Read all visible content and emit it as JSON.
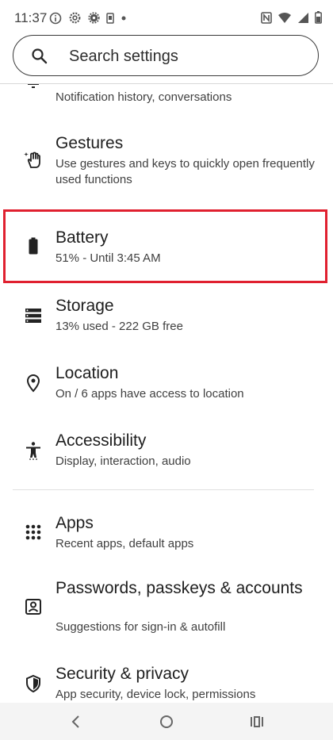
{
  "status_bar": {
    "time": "11:37",
    "left_icons": [
      "info-icon",
      "settings-gear-icon",
      "settings-cog-icon",
      "device-icon",
      "dot-icon"
    ],
    "right_icons": [
      "nfc-icon",
      "wifi-icon",
      "signal-icon",
      "battery-icon"
    ]
  },
  "search": {
    "placeholder": "Search settings"
  },
  "items": [
    {
      "id": "notifications",
      "title": "",
      "subtitle": "Notification history, conversations",
      "icon": "bell-icon"
    },
    {
      "id": "gestures",
      "title": "Gestures",
      "subtitle": "Use gestures and keys to quickly open frequently used functions",
      "icon": "gesture-hand-icon"
    },
    {
      "id": "battery",
      "title": "Battery",
      "subtitle": "51% - Until 3:45 AM",
      "icon": "battery-icon",
      "highlighted": true
    },
    {
      "id": "storage",
      "title": "Storage",
      "subtitle": "13% used - 222 GB free",
      "icon": "storage-icon"
    },
    {
      "id": "location",
      "title": "Location",
      "subtitle": "On / 6 apps have access to location",
      "icon": "location-pin-icon"
    },
    {
      "id": "accessibility",
      "title": "Accessibility",
      "subtitle": "Display, interaction, audio",
      "icon": "accessibility-icon"
    },
    {
      "id": "apps",
      "title": "Apps",
      "subtitle": "Recent apps, default apps",
      "icon": "apps-grid-icon"
    },
    {
      "id": "passwords",
      "title": "Passwords, passkeys & accounts",
      "subtitle": "Suggestions for sign-in & autofill",
      "icon": "account-box-icon"
    },
    {
      "id": "security",
      "title": "Security & privacy",
      "subtitle": "App security, device lock, permissions",
      "icon": "shield-icon"
    }
  ],
  "nav": {
    "back": "back-icon",
    "home": "home-icon",
    "recents": "recents-icon"
  },
  "colors": {
    "highlight": "#e0202f",
    "text": "#1e1e1e",
    "nav_bg": "#f4f4f4"
  }
}
